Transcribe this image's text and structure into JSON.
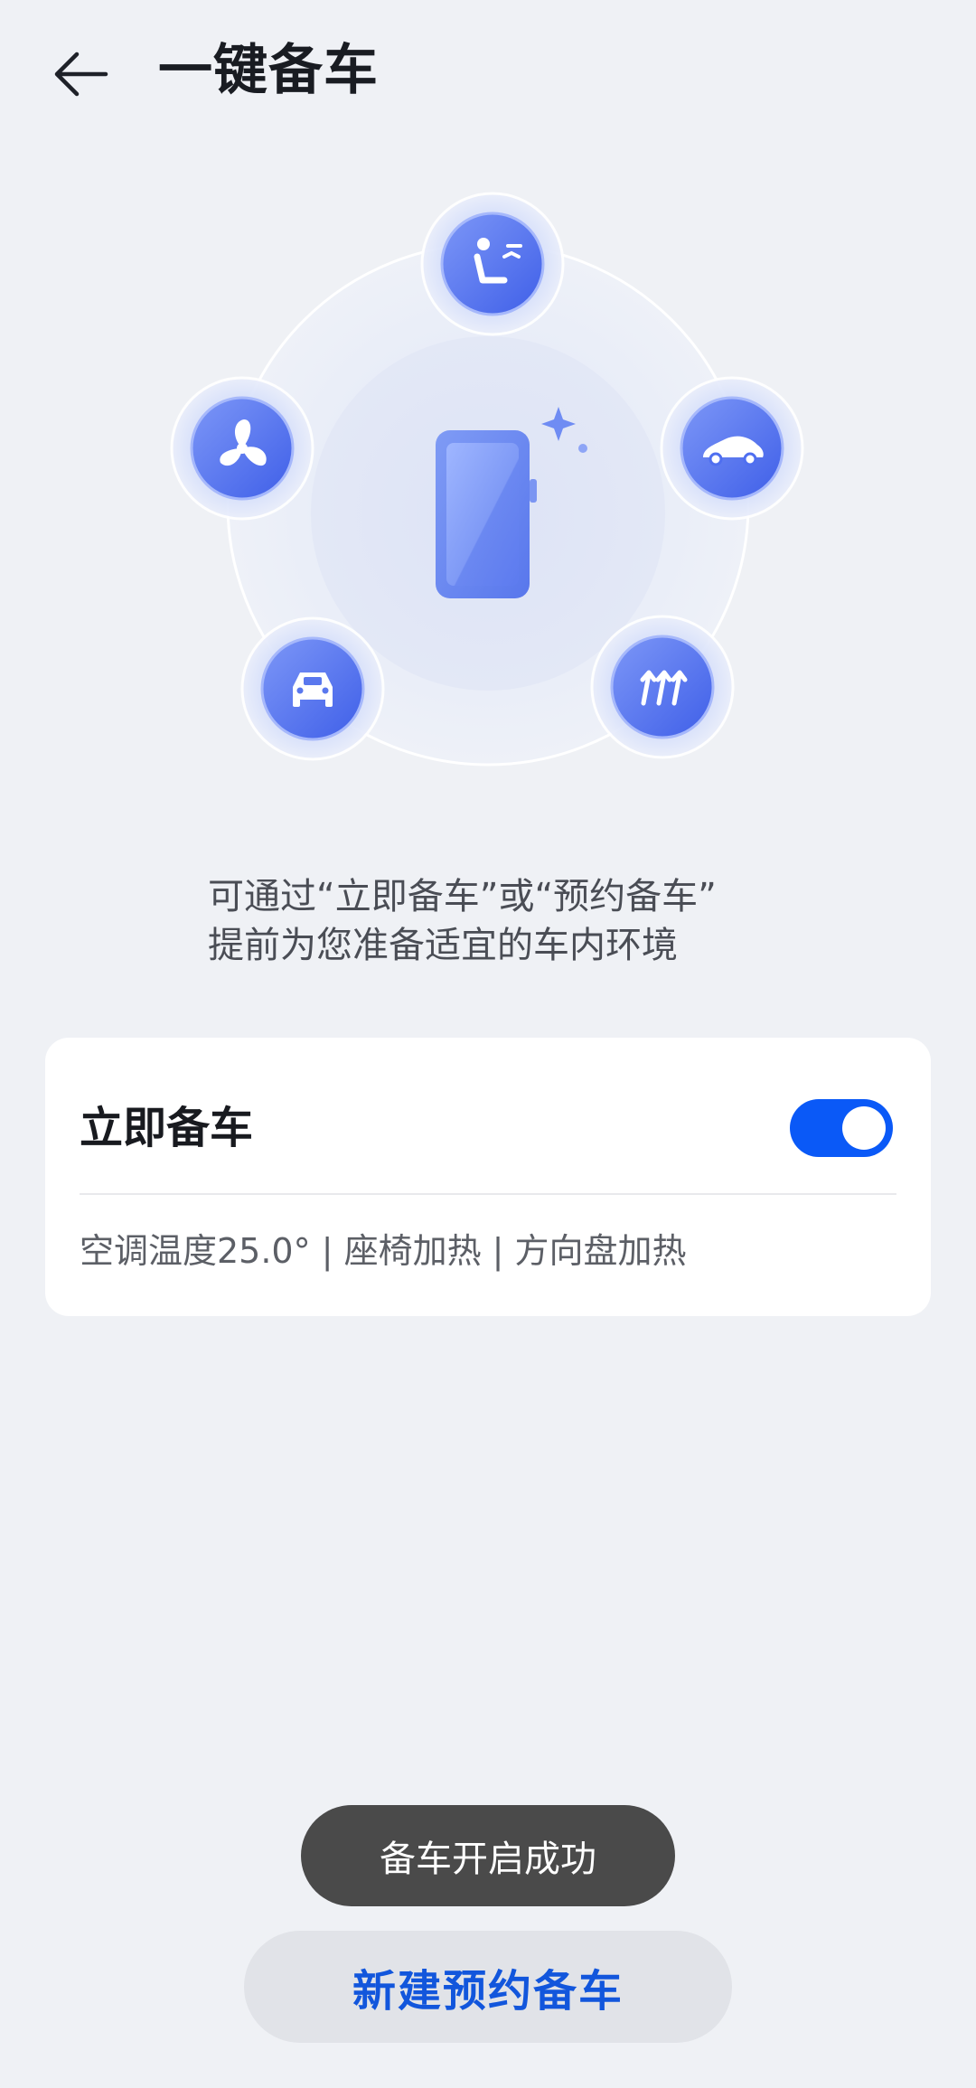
{
  "header": {
    "title": "一键备车"
  },
  "hero": {
    "icons": [
      "seat-heat-icon",
      "car-side-icon",
      "defrost-icon",
      "car-front-icon",
      "fan-icon",
      "phone-sparkle-icon"
    ]
  },
  "intro": {
    "line1": "可通过“立即备车”或“预约备车”",
    "line2": "提前为您准备适宜的车内环境"
  },
  "card": {
    "title": "立即备车",
    "toggle_on": true,
    "description": "空调温度25.0° | 座椅加热 | 方向盘加热"
  },
  "toast": {
    "text": "备车开启成功"
  },
  "footer": {
    "new_button_label": "新建预约备车"
  },
  "colors": {
    "accent": "#0a59f7",
    "accent_text": "#1256dc",
    "background": "#eff1f5",
    "icon_blue": "#4f6ff0"
  }
}
